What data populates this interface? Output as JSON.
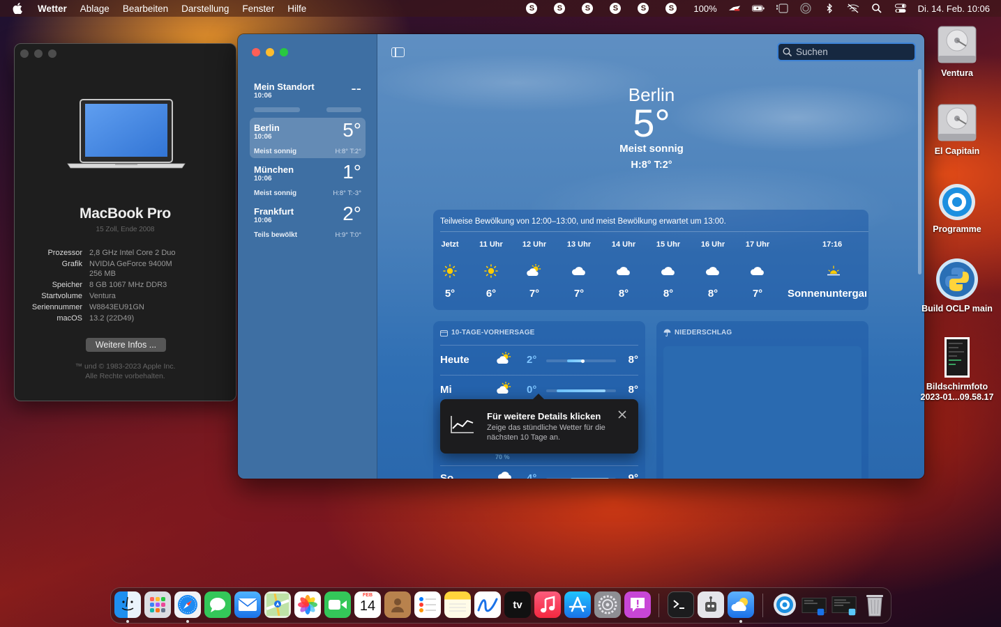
{
  "menubar": {
    "app_name": "Wetter",
    "items": [
      "Ablage",
      "Bearbeiten",
      "Darstellung",
      "Fenster",
      "Hilfe"
    ],
    "battery_percent": "100%",
    "datetime": "Di. 14. Feb. 10:06",
    "s_icon_letter": "S"
  },
  "about": {
    "model": "MacBook Pro",
    "model_sub": "15 Zoll, Ende 2008",
    "specs": [
      {
        "key": "Prozessor",
        "value": "2,8 GHz Intel Core 2 Duo"
      },
      {
        "key": "Grafik",
        "value": "NVIDIA GeForce 9400M"
      },
      {
        "key": "",
        "value": "256 MB"
      },
      {
        "key": "Speicher",
        "value": "8 GB 1067 MHz DDR3"
      },
      {
        "key": "Startvolume",
        "value": "Ventura"
      },
      {
        "key": "Seriennummer",
        "value": "W8843EU91GN"
      },
      {
        "key": "macOS",
        "value": "13.2 (22D49)"
      }
    ],
    "more_button": "Weitere Infos ...",
    "copyright_line1": "™ und © 1983-2023 Apple Inc.",
    "copyright_line2": "Alle Rechte vorbehalten."
  },
  "weather": {
    "locations": [
      {
        "name": "Mein Standort",
        "time": "10:06",
        "temp": "--",
        "cond": "",
        "hl": ""
      },
      {
        "name": "Berlin",
        "time": "10:06",
        "temp": "5°",
        "cond": "Meist sonnig",
        "hl": "H:8°  T:2°"
      },
      {
        "name": "München",
        "time": "10:06",
        "temp": "1°",
        "cond": "Meist sonnig",
        "hl": "H:8°  T:-3°"
      },
      {
        "name": "Frankfurt",
        "time": "10:06",
        "temp": "2°",
        "cond": "Teils bewölkt",
        "hl": "H:9°  T:0°"
      }
    ],
    "search_placeholder": "Suchen",
    "hero": {
      "city": "Berlin",
      "temp": "5°",
      "cond": "Meist sonnig",
      "hl": "H:8°  T:2°"
    },
    "hourly": {
      "description": "Teilweise Bewölkung von 12:00–13:00, und meist Bewölkung erwartet um 13:00.",
      "items": [
        {
          "label": "Jetzt",
          "icon": "sun",
          "temp": "5°"
        },
        {
          "label": "11 Uhr",
          "icon": "sun",
          "temp": "6°"
        },
        {
          "label": "12 Uhr",
          "icon": "partly-cloudy",
          "temp": "7°"
        },
        {
          "label": "13 Uhr",
          "icon": "cloud",
          "temp": "7°"
        },
        {
          "label": "14 Uhr",
          "icon": "cloud",
          "temp": "8°"
        },
        {
          "label": "15 Uhr",
          "icon": "cloud",
          "temp": "8°"
        },
        {
          "label": "16 Uhr",
          "icon": "cloud",
          "temp": "8°"
        },
        {
          "label": "17 Uhr",
          "icon": "cloud",
          "temp": "7°"
        },
        {
          "label": "17:16",
          "icon": "sunset",
          "temp": "Sonnenuntergang"
        }
      ]
    },
    "tenday": {
      "header": "10-TAGE-VORHERSAGE",
      "rows": [
        {
          "day": "Heute",
          "icon": "partly-cloudy",
          "lo": "2°",
          "hi": "8°",
          "fill_start": 0.3,
          "fill_end": 0.55
        },
        {
          "day": "Mi",
          "icon": "partly-cloudy",
          "lo": "0°",
          "hi": "8°",
          "fill_start": 0.15,
          "fill_end": 0.85
        },
        {
          "day": "So",
          "icon": "cloud",
          "lo": "4°",
          "hi": "9°",
          "fill_start": 0.35,
          "fill_end": 0.9
        }
      ],
      "precip_chance": "70 %"
    },
    "precip_header": "NIEDERSCHLAG",
    "tooltip": {
      "title": "Für weitere Details klicken",
      "body": "Zeige das stündliche Wetter für die nächsten 10 Tage an."
    }
  },
  "desktop": {
    "icons": [
      {
        "label": "Ventura"
      },
      {
        "label": "El Capitain"
      },
      {
        "label": "Programme"
      },
      {
        "label": "Build OCLP main"
      },
      {
        "label": "Bildschirmfoto\n2023-01...09.58.17"
      }
    ]
  },
  "dock": {
    "calendar_month": "FEB",
    "calendar_day": "14",
    "appletv_label": "tv"
  }
}
